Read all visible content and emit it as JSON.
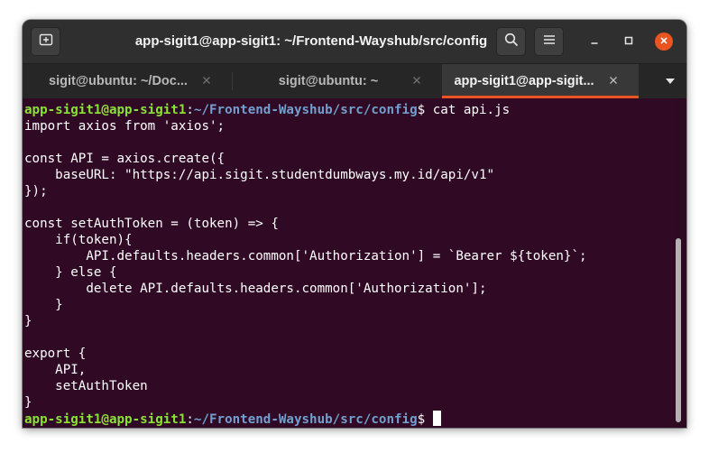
{
  "window": {
    "title": "app-sigit1@app-sigit1: ~/Frontend-Wayshub/src/config"
  },
  "tabs": [
    {
      "label": "sigit@ubuntu: ~/Doc...",
      "active": false
    },
    {
      "label": "sigit@ubuntu: ~",
      "active": false
    },
    {
      "label": "app-sigit1@app-sigit...",
      "active": true
    }
  ],
  "icons": {
    "new_tab": "new-tab-icon",
    "search": "search-icon",
    "menu": "hamburger-menu-icon",
    "minimize": "minimize-icon",
    "maximize": "maximize-icon",
    "close": "close-icon",
    "tab_close": "close-icon",
    "tabs_dropdown": "chevron-down-icon"
  },
  "colors": {
    "terminal_bg": "#300a24",
    "prompt_user": "#8ae234",
    "prompt_path": "#729fcf",
    "close_button": "#e95420",
    "tab_accent": "#e95420"
  },
  "terminal": {
    "prompt": {
      "user_host": "app-sigit1@app-sigit1",
      "colon": ":",
      "path": "~/Frontend-Wayshub/src/config",
      "symbol": "$ "
    },
    "command": "cat api.js",
    "output": [
      "import axios from 'axios';",
      "",
      "const API = axios.create({",
      "    baseURL: \"https://api.sigit.studentdumbways.my.id/api/v1\"",
      "});",
      "",
      "const setAuthToken = (token) => {",
      "    if(token){",
      "        API.defaults.headers.common['Authorization'] = `Bearer ${token}`;",
      "    } else {",
      "        delete API.defaults.headers.common['Authorization'];",
      "    }",
      "}",
      "",
      "export {",
      "    API,",
      "    setAuthToken",
      "}"
    ]
  }
}
